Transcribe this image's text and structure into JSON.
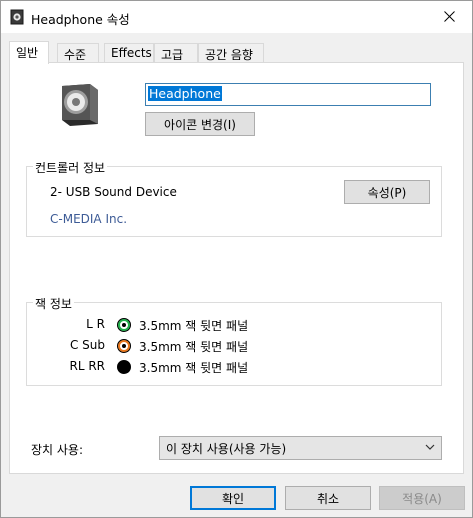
{
  "window": {
    "title": "Headphone 속성"
  },
  "tabs": [
    {
      "label": "일반",
      "active": true
    },
    {
      "label": "수준",
      "active": false
    },
    {
      "label": "Effects",
      "active": false
    },
    {
      "label": "고급",
      "active": false
    },
    {
      "label": "공간 음향",
      "active": false
    }
  ],
  "general": {
    "device_name": "Headphone",
    "change_icon_label": "아이콘 변경(I)"
  },
  "controller": {
    "group_label": "컨트롤러 정보",
    "device": "2- USB Sound Device",
    "vendor": "C-MEDIA Inc.",
    "properties_label": "속성(P)"
  },
  "jack": {
    "group_label": "잭 정보",
    "rows": [
      {
        "label": "L R",
        "color": "#22b14c",
        "desc": "3.5mm 잭 뒷면 패널"
      },
      {
        "label": "C Sub",
        "color": "#e8761c",
        "desc": "3.5mm 잭 뒷면 패널"
      },
      {
        "label": "RL RR",
        "color": "#000000",
        "desc": "3.5mm 잭 뒷면 패널"
      }
    ]
  },
  "usage": {
    "label": "장치 사용:",
    "selected": "이 장치 사용(사용 가능)"
  },
  "buttons": {
    "ok": "확인",
    "cancel": "취소",
    "apply": "적용(A)"
  },
  "colors": {
    "accent": "#0078d7",
    "vendor_link": "#3d5b96"
  }
}
